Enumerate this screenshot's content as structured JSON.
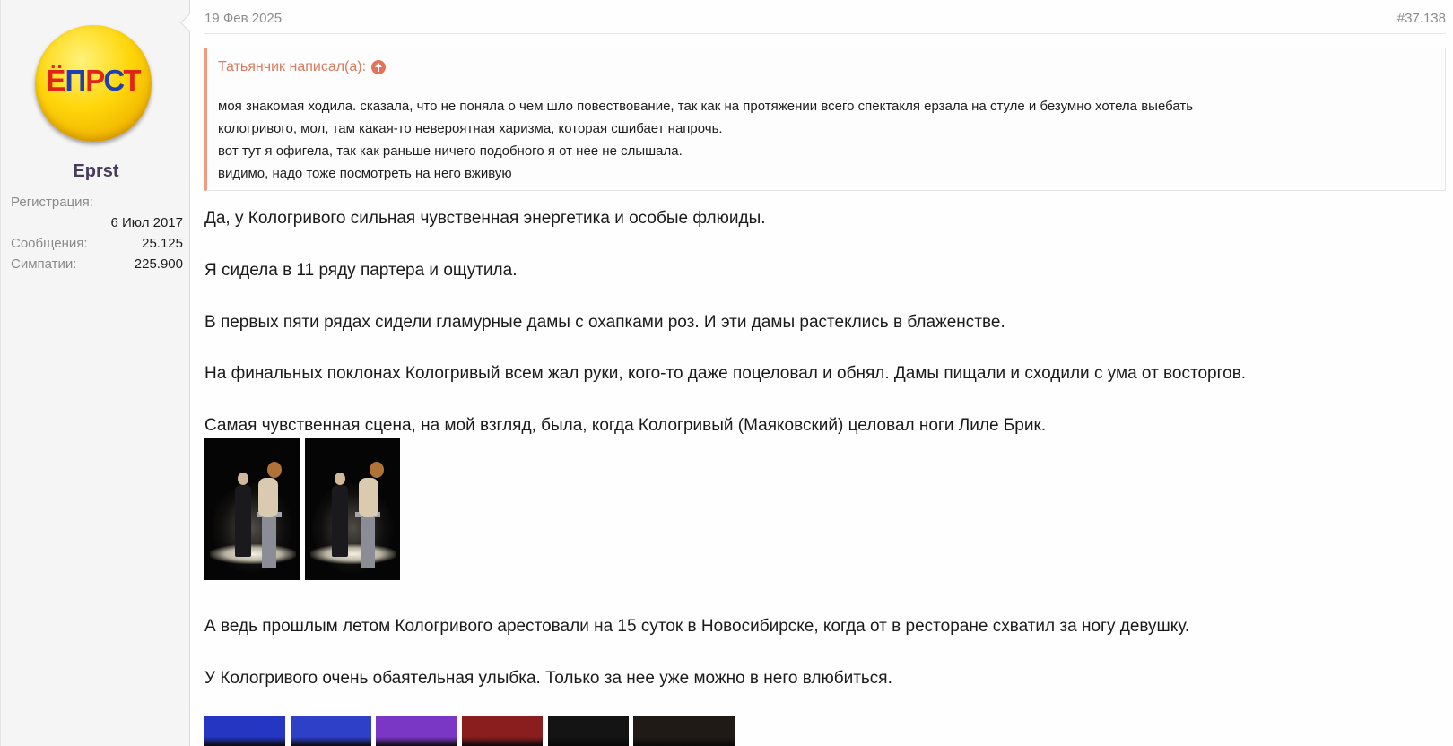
{
  "user": {
    "avatar_letters": [
      "Ё",
      "П",
      "Р",
      "С",
      "Т"
    ],
    "name": "Eprst",
    "registration_label": "Регистрация:",
    "registration_value": "6 Июл 2017",
    "messages_label": "Сообщения:",
    "messages_value": "25.125",
    "likes_label": "Симпатии:",
    "likes_value": "225.900"
  },
  "post": {
    "date": "19 Фев 2025",
    "number": "#37.138"
  },
  "quote": {
    "author_label": "Татьянчик написал(а):",
    "icon": "arrow-up-circle-icon",
    "lines": [
      "моя знакомая ходила. сказала, что не поняла о чем шло повествование, так как на протяжении всего спектакля ерзала на стуле и безумно хотела выебать",
      "кологривого, мол, там какая-то невероятная харизма, которая сшибает напрочь.",
      "вот тут я офигела, так как раньше ничего подобного я от нее не слышала.",
      "видимо, надо тоже посмотреть на него вживую"
    ]
  },
  "message": {
    "paragraphs": [
      "Да, у Кологривого сильная чувственная энергетика и особые флюиды.",
      "Я сидела в 11 ряду партера и ощутила.",
      "В первых пяти рядах сидели гламурные дамы с охапками роз. И эти дамы растеклись в блаженстве.",
      "На финальных поклонах Кологривый всем жал руки, кого-то даже поцеловал и обнял. Дамы пищали и сходили с ума от восторгов.",
      "Самая чувственная сцена, на мой взгляд, была, когда Кологривый (Маяковский) целовал ноги Лиле Брик.",
      "А ведь прошлым летом Кологривого арестовали на 15 суток в Новосибирске, когда от в ресторане схватил за ногу девушку.",
      "У Кологривого очень обаятельная улыбка. Только за нее уже можно в него влюбиться."
    ],
    "photo_count": 2,
    "thumbnail_colors": [
      "#2436c2",
      "#2e3fc8",
      "#7a36c4",
      "#8a1d1d",
      "#141414",
      "#201a16"
    ]
  },
  "colors": {
    "quote_accent": "#f09a82",
    "quote_title": "#d97b5f",
    "username": "#4a3b5c"
  }
}
